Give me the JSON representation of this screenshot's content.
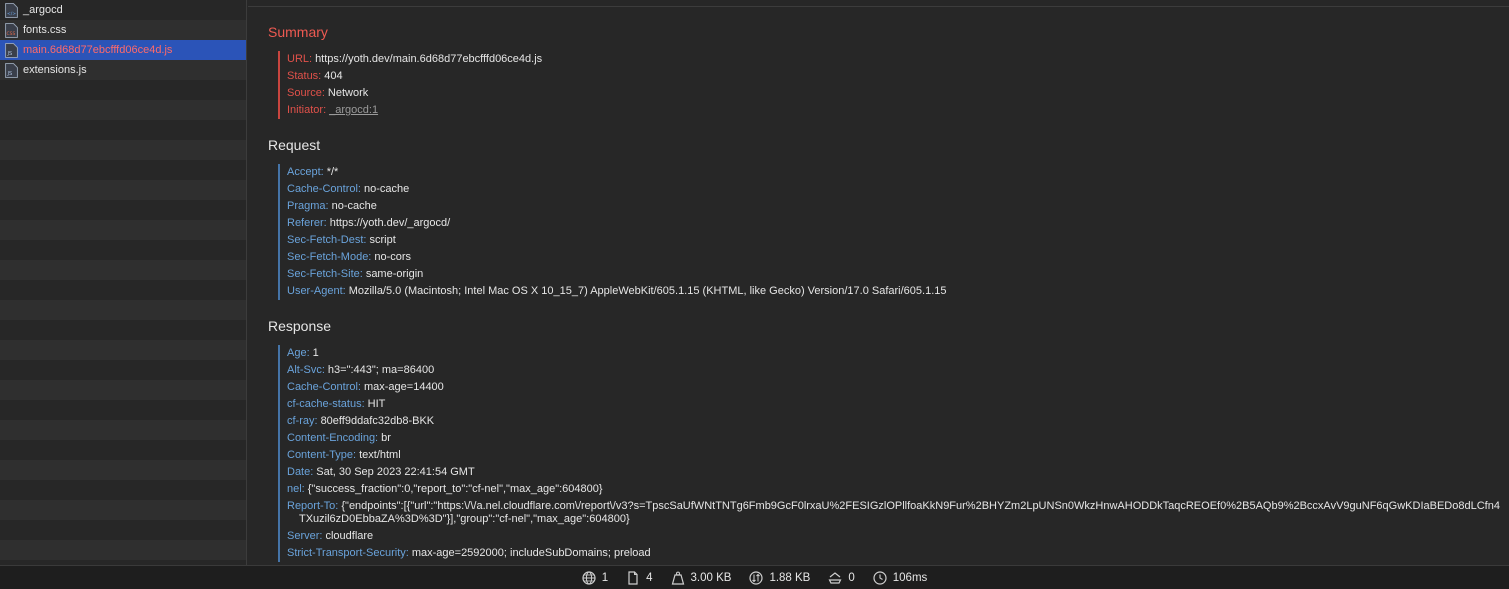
{
  "sidebar": {
    "files": [
      {
        "name": "_argocd",
        "icon": "html-document-icon",
        "selected": false
      },
      {
        "name": "fonts.css",
        "icon": "css-document-icon",
        "selected": false
      },
      {
        "name": "main.6d68d77ebcfffd06ce4d.js",
        "icon": "js-document-icon",
        "selected": true
      },
      {
        "name": "extensions.js",
        "icon": "js-document-icon",
        "selected": false
      }
    ]
  },
  "summary": {
    "title": "Summary",
    "url_key": "URL:",
    "url": "https://yoth.dev/main.6d68d77ebcfffd06ce4d.js",
    "status_key": "Status:",
    "status": "404",
    "source_key": "Source:",
    "source": "Network",
    "initiator_key": "Initiator:",
    "initiator": "_argocd:1"
  },
  "request": {
    "title": "Request",
    "headers": [
      {
        "key": "Accept:",
        "value": "*/*"
      },
      {
        "key": "Cache-Control:",
        "value": "no-cache"
      },
      {
        "key": "Pragma:",
        "value": "no-cache"
      },
      {
        "key": "Referer:",
        "value": "https://yoth.dev/_argocd/"
      },
      {
        "key": "Sec-Fetch-Dest:",
        "value": "script"
      },
      {
        "key": "Sec-Fetch-Mode:",
        "value": "no-cors"
      },
      {
        "key": "Sec-Fetch-Site:",
        "value": "same-origin"
      },
      {
        "key": "User-Agent:",
        "value": "Mozilla/5.0 (Macintosh; Intel Mac OS X 10_15_7) AppleWebKit/605.1.15 (KHTML, like Gecko) Version/17.0 Safari/605.1.15"
      }
    ]
  },
  "response": {
    "title": "Response",
    "headers": [
      {
        "key": "Age:",
        "value": "1"
      },
      {
        "key": "Alt-Svc:",
        "value": "h3=\":443\"; ma=86400"
      },
      {
        "key": "Cache-Control:",
        "value": "max-age=14400"
      },
      {
        "key": "cf-cache-status:",
        "value": "HIT"
      },
      {
        "key": "cf-ray:",
        "value": "80eff9ddafc32db8-BKK"
      },
      {
        "key": "Content-Encoding:",
        "value": "br"
      },
      {
        "key": "Content-Type:",
        "value": "text/html"
      },
      {
        "key": "Date:",
        "value": "Sat, 30 Sep 2023 22:41:54 GMT"
      },
      {
        "key": "nel:",
        "value": "{\"success_fraction\":0,\"report_to\":\"cf-nel\",\"max_age\":604800}"
      },
      {
        "key": "Report-To:",
        "value": "{\"endpoints\":[{\"url\":\"https:\\/\\/a.nel.cloudflare.com\\/report\\/v3?s=TpscSaUfWNtTNTg6Fmb9GcF0lrxaU%2FESIGzlOPllfoaKkN9Fur%2BHYZm2LpUNSn0WkzHnwAHODDkTaqcREOEf0%2B5AQb9%2BccxAvV9guNF6qGwKDIaBEDo8dLCfn4TXuzil6zD0EbbaZA%3D%3D\"}],\"group\":\"cf-nel\",\"max_age\":604800}"
      },
      {
        "key": "Server:",
        "value": "cloudflare"
      },
      {
        "key": "Strict-Transport-Security:",
        "value": "max-age=2592000; includeSubDomains; preload"
      }
    ]
  },
  "statusbar": {
    "resources": {
      "icon": "globe-icon",
      "value": "1"
    },
    "documents": {
      "icon": "document-icon",
      "value": "4"
    },
    "size": {
      "icon": "weight-icon",
      "value": "3.00 KB"
    },
    "transferred": {
      "icon": "transfer-icon",
      "value": "1.88 KB"
    },
    "cached": {
      "icon": "cache-icon",
      "value": "0"
    },
    "time": {
      "icon": "clock-icon",
      "value": "106ms"
    }
  }
}
